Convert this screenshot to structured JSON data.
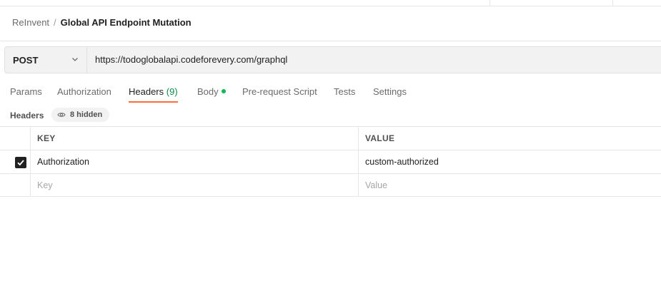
{
  "breadcrumb": {
    "parent": "ReInvent",
    "separator": "/",
    "current": "Global API Endpoint Mutation"
  },
  "request": {
    "method": "POST",
    "url": "https://todoglobalapi.codeforevery.com/graphql"
  },
  "tabs": {
    "params": "Params",
    "authorization": "Authorization",
    "headers": "Headers",
    "headers_count": "(9)",
    "body": "Body",
    "pre_request": "Pre-request Script",
    "tests": "Tests",
    "settings": "Settings"
  },
  "headers_section": {
    "label": "Headers",
    "hidden_text": "8 hidden"
  },
  "table": {
    "columns": {
      "key": "KEY",
      "value": "VALUE"
    },
    "rows": [
      {
        "key": "Authorization",
        "value": "custom-authorized",
        "enabled": true
      }
    ],
    "new_row": {
      "key_placeholder": "Key",
      "value_placeholder": "Value"
    }
  },
  "colors": {
    "active_tab_underline": "#ff6c37",
    "body_dot": "#0cbb52",
    "headers_count": "#0a8a4a"
  },
  "icons": {
    "method_dropdown": "chevron-down-icon",
    "hidden_headers": "eye-icon",
    "row_enabled": "checkbox-checked-icon"
  }
}
